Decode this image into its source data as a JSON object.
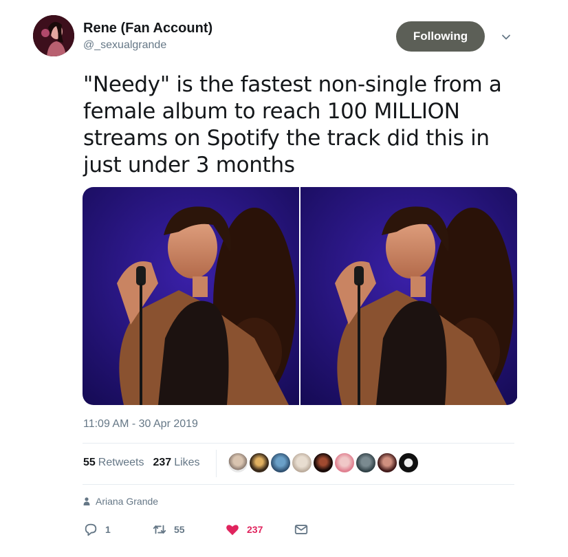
{
  "author": {
    "display_name": "Rene (Fan Account)",
    "handle": "@_sexualgrande",
    "avatar_icon": "profile-photo"
  },
  "follow_button": {
    "label": "Following",
    "color": "#5c5f57"
  },
  "more_menu_icon": "chevron-down-icon",
  "tweet": {
    "text": "\"Needy\" is the fastest non-single from a female album to reach 100 MILLION streams on Spotify the track did this in just under 3 months",
    "media": [
      {
        "name": "photo-1",
        "description_icon": "photo"
      },
      {
        "name": "photo-2",
        "description_icon": "photo"
      }
    ],
    "timestamp": "11:09 AM - 30 Apr 2019"
  },
  "stats": {
    "retweets_count": "55",
    "retweets_label": "Retweets",
    "likes_count": "237",
    "likes_label": "Likes",
    "liker_avatar_count": 9
  },
  "place": {
    "icon": "person-icon",
    "label": "Ariana Grande"
  },
  "actions": {
    "reply_count": "1",
    "retweet_count": "55",
    "like_count": "237",
    "like_color": "#e0245e"
  },
  "colors": {
    "text": "#14171a",
    "secondary": "#657786",
    "divider": "#e6ecf0"
  }
}
